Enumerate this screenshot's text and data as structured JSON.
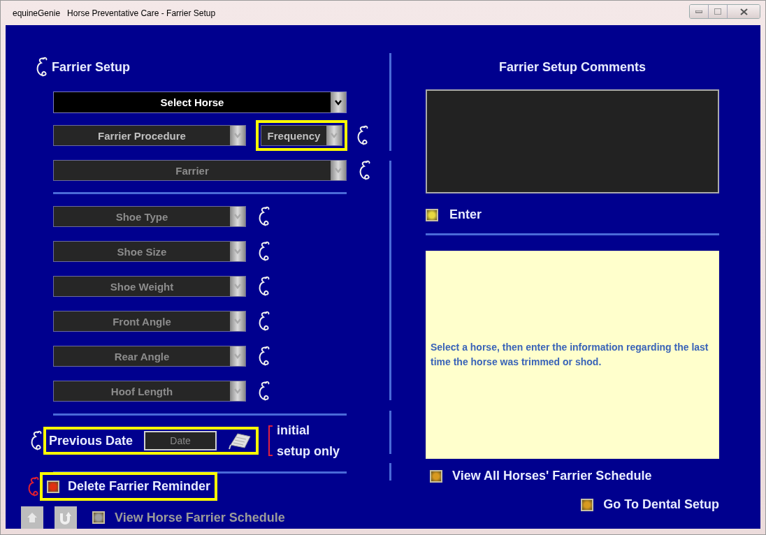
{
  "window": {
    "title": "equineGenie   Horse Preventative Care - Farrier Setup"
  },
  "setup": {
    "title": "Farrier Setup",
    "horse": {
      "label": "Select Horse",
      "disabled": false,
      "help": false
    },
    "procedure": {
      "label": "Farrier Procedure",
      "disabled": true,
      "help": false
    },
    "frequency": {
      "label": "Frequency",
      "disabled": true,
      "help": true,
      "highlighted": true
    },
    "farrier": {
      "label": "Farrier",
      "disabled": true,
      "help": true
    },
    "attributes": [
      {
        "label": "Shoe Type",
        "disabled": true,
        "help": true
      },
      {
        "label": "Shoe Size",
        "disabled": true,
        "help": true
      },
      {
        "label": "Shoe Weight",
        "disabled": true,
        "help": true
      },
      {
        "label": "Front Angle",
        "disabled": true,
        "help": true
      },
      {
        "label": "Rear Angle",
        "disabled": true,
        "help": true
      },
      {
        "label": "Hoof Length",
        "disabled": true,
        "help": true
      }
    ],
    "previous_date": {
      "label": "Previous Date",
      "placeholder": "Date",
      "highlighted": true,
      "note_line_1": "initial",
      "note_line_2": "setup only"
    },
    "delete_reminder": {
      "label": "Delete Farrier Reminder",
      "color": "#e03010",
      "disabled": false,
      "highlighted": true
    },
    "view_horse_schedule": {
      "label": "View Horse Farrier Schedule",
      "color": "#a0a0a0",
      "disabled": true
    }
  },
  "comments": {
    "title": "Farrier Setup Comments",
    "enter": {
      "label": "Enter",
      "color": "#e8d840",
      "disabled": false
    },
    "info": "Select a horse, then enter the information regarding the last time the horse was trimmed or shod.",
    "view_all": {
      "label": "View All Horses' Farrier Schedule",
      "color": "#d89a20",
      "disabled": false
    },
    "dental": {
      "label": "Go To Dental Setup",
      "color": "#d89a20",
      "disabled": false
    }
  }
}
